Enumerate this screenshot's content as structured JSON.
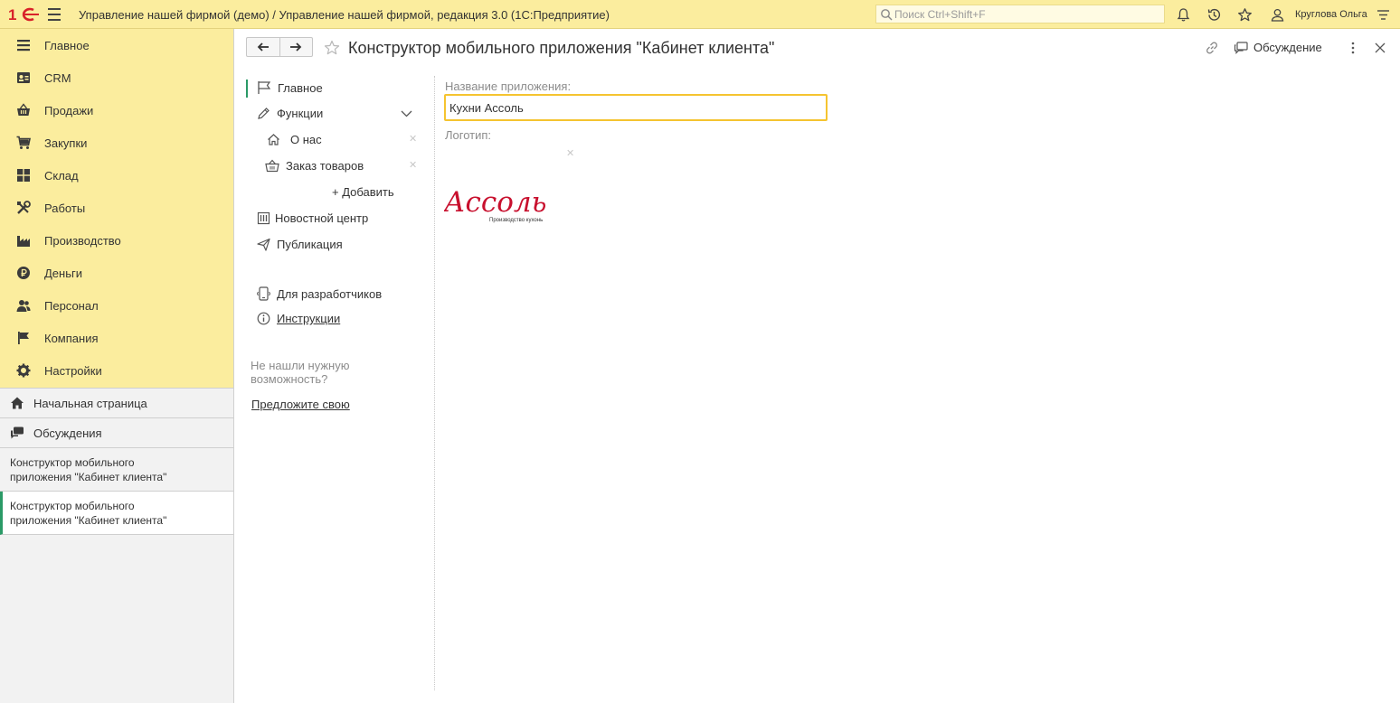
{
  "topbar": {
    "app_title": "Управление нашей фирмой (демо) / Управление нашей фирмой, редакция 3.0  (1С:Предприятие)",
    "search_placeholder": "Поиск Ctrl+Shift+F",
    "user_name": "Круглова Ольга",
    "accent_color": "#fbed9e"
  },
  "sidebar": {
    "sections": [
      {
        "label": "Главное",
        "icon": "menu-list-icon"
      },
      {
        "label": "CRM",
        "icon": "contact-card-icon"
      },
      {
        "label": "Продажи",
        "icon": "basket-icon"
      },
      {
        "label": "Закупки",
        "icon": "cart-icon"
      },
      {
        "label": "Склад",
        "icon": "warehouse-grid-icon"
      },
      {
        "label": "Работы",
        "icon": "tools-icon"
      },
      {
        "label": "Производство",
        "icon": "factory-icon"
      },
      {
        "label": "Деньги",
        "icon": "ruble-coin-icon"
      },
      {
        "label": "Персонал",
        "icon": "people-icon"
      },
      {
        "label": "Компания",
        "icon": "flag-icon"
      },
      {
        "label": "Настройки",
        "icon": "gear-icon"
      }
    ],
    "home_page": "Начальная страница",
    "discussions": "Обсуждения",
    "open_windows": [
      {
        "line1": "Конструктор мобильного",
        "line2": "приложения \"Кабинет клиента\"",
        "active": false
      },
      {
        "line1": "Конструктор мобильного",
        "line2": "приложения \"Кабинет клиента\"",
        "active": true
      }
    ]
  },
  "form": {
    "title": "Конструктор мобильного приложения \"Кабинет клиента\"",
    "discuss_label": "Обсуждение",
    "nav": {
      "main": "Главное",
      "functions": "Функции",
      "about": "О нас",
      "order": "Заказ товаров",
      "add": "+ Добавить",
      "news": "Новостной центр",
      "publish": "Публикация",
      "developers": "Для разработчиков",
      "instructions": "Инструкции"
    },
    "hint": "Не нашли нужную возможность?",
    "suggest": "Предложите свою",
    "fields": {
      "name_label": "Название приложения:",
      "name_value": "Кухни Ассоль",
      "logo_label": "Логотип:"
    },
    "logo": {
      "brand": "Ассоль",
      "tagline": "Производство кухонь",
      "color": "#c8102e"
    }
  }
}
